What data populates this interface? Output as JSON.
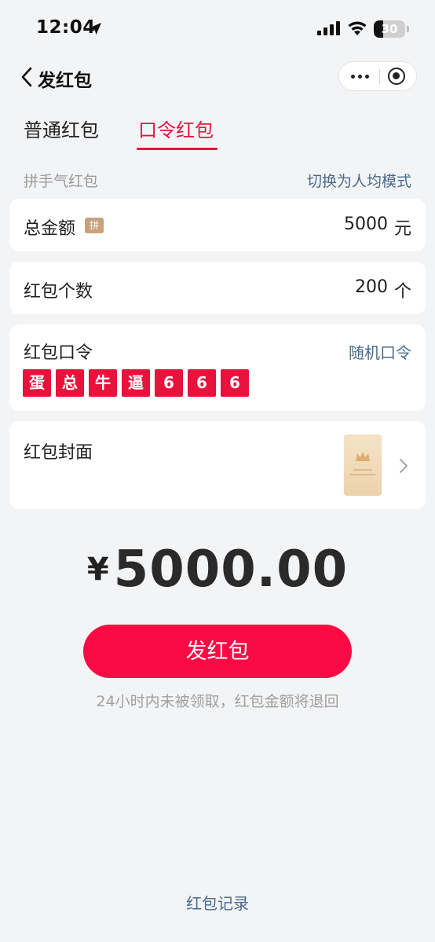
{
  "status_bar": {
    "time": "12:04",
    "battery": "30",
    "battery_level": 0.3,
    "icons": [
      "location-arrow-icon",
      "signal-icon",
      "wifi-icon",
      "battery-icon"
    ]
  },
  "nav": {
    "title": "发红包",
    "icons": [
      "back-icon",
      "more-icon",
      "close-mini-program-icon"
    ]
  },
  "tabs": [
    {
      "label": "普通红包",
      "active": false
    },
    {
      "label": "口令红包",
      "active": true
    }
  ],
  "mode": {
    "label": "拼手气红包",
    "switch": "切换为人均模式"
  },
  "amount": {
    "label": "总金额",
    "badge": "拼",
    "value": "5000",
    "unit": "元"
  },
  "count": {
    "label": "红包个数",
    "value": "200",
    "unit": "个"
  },
  "password": {
    "label": "红包口令",
    "random_label": "随机口令",
    "chars": [
      "蛋",
      "总",
      "牛",
      "逼",
      "6",
      "6",
      "6"
    ]
  },
  "cover": {
    "label": "红包封面"
  },
  "total": {
    "currency": "¥",
    "amount": "5000.00"
  },
  "send_label": "发红包",
  "notice": "24小时内未被领取，红包金额将退回",
  "records_label": "红包记录",
  "colors": {
    "accent_red": "#e8123c",
    "button_red": "#fb0a43",
    "link_blue": "#4a6a8c",
    "background": "#f3f4f6"
  }
}
